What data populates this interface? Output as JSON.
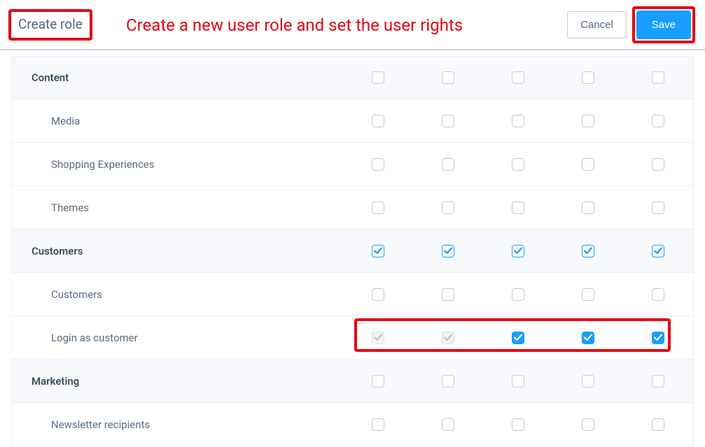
{
  "header": {
    "title": "Create role",
    "annotation": "Create a new user role and set the user rights",
    "cancel_label": "Cancel",
    "save_label": "Save"
  },
  "rows": [
    {
      "label": "Content",
      "type": "group",
      "cells": [
        "unchecked",
        "unchecked",
        "unchecked",
        "unchecked",
        "unchecked"
      ]
    },
    {
      "label": "Media",
      "type": "child",
      "cells": [
        "unchecked",
        "unchecked",
        "unchecked",
        "unchecked",
        "unchecked"
      ]
    },
    {
      "label": "Shopping Experiences",
      "type": "child",
      "cells": [
        "unchecked",
        "unchecked",
        "unchecked",
        "unchecked",
        "unchecked"
      ]
    },
    {
      "label": "Themes",
      "type": "child",
      "cells": [
        "unchecked",
        "unchecked",
        "unchecked",
        "unchecked",
        "unchecked"
      ]
    },
    {
      "label": "Customers",
      "type": "group",
      "cells": [
        "partial",
        "partial",
        "partial",
        "partial",
        "partial"
      ]
    },
    {
      "label": "Customers",
      "type": "child",
      "cells": [
        "unchecked",
        "unchecked",
        "unchecked",
        "unchecked",
        "unchecked"
      ]
    },
    {
      "label": "Login as customer",
      "type": "child",
      "cells": [
        "disabled-checked",
        "disabled-checked",
        "checked",
        "checked",
        "checked"
      ]
    },
    {
      "label": "Marketing",
      "type": "group",
      "cells": [
        "unchecked",
        "unchecked",
        "unchecked",
        "unchecked",
        "unchecked"
      ]
    },
    {
      "label": "Newsletter recipients",
      "type": "child",
      "cells": [
        "unchecked",
        "unchecked",
        "unchecked",
        "unchecked",
        "unchecked"
      ]
    }
  ]
}
